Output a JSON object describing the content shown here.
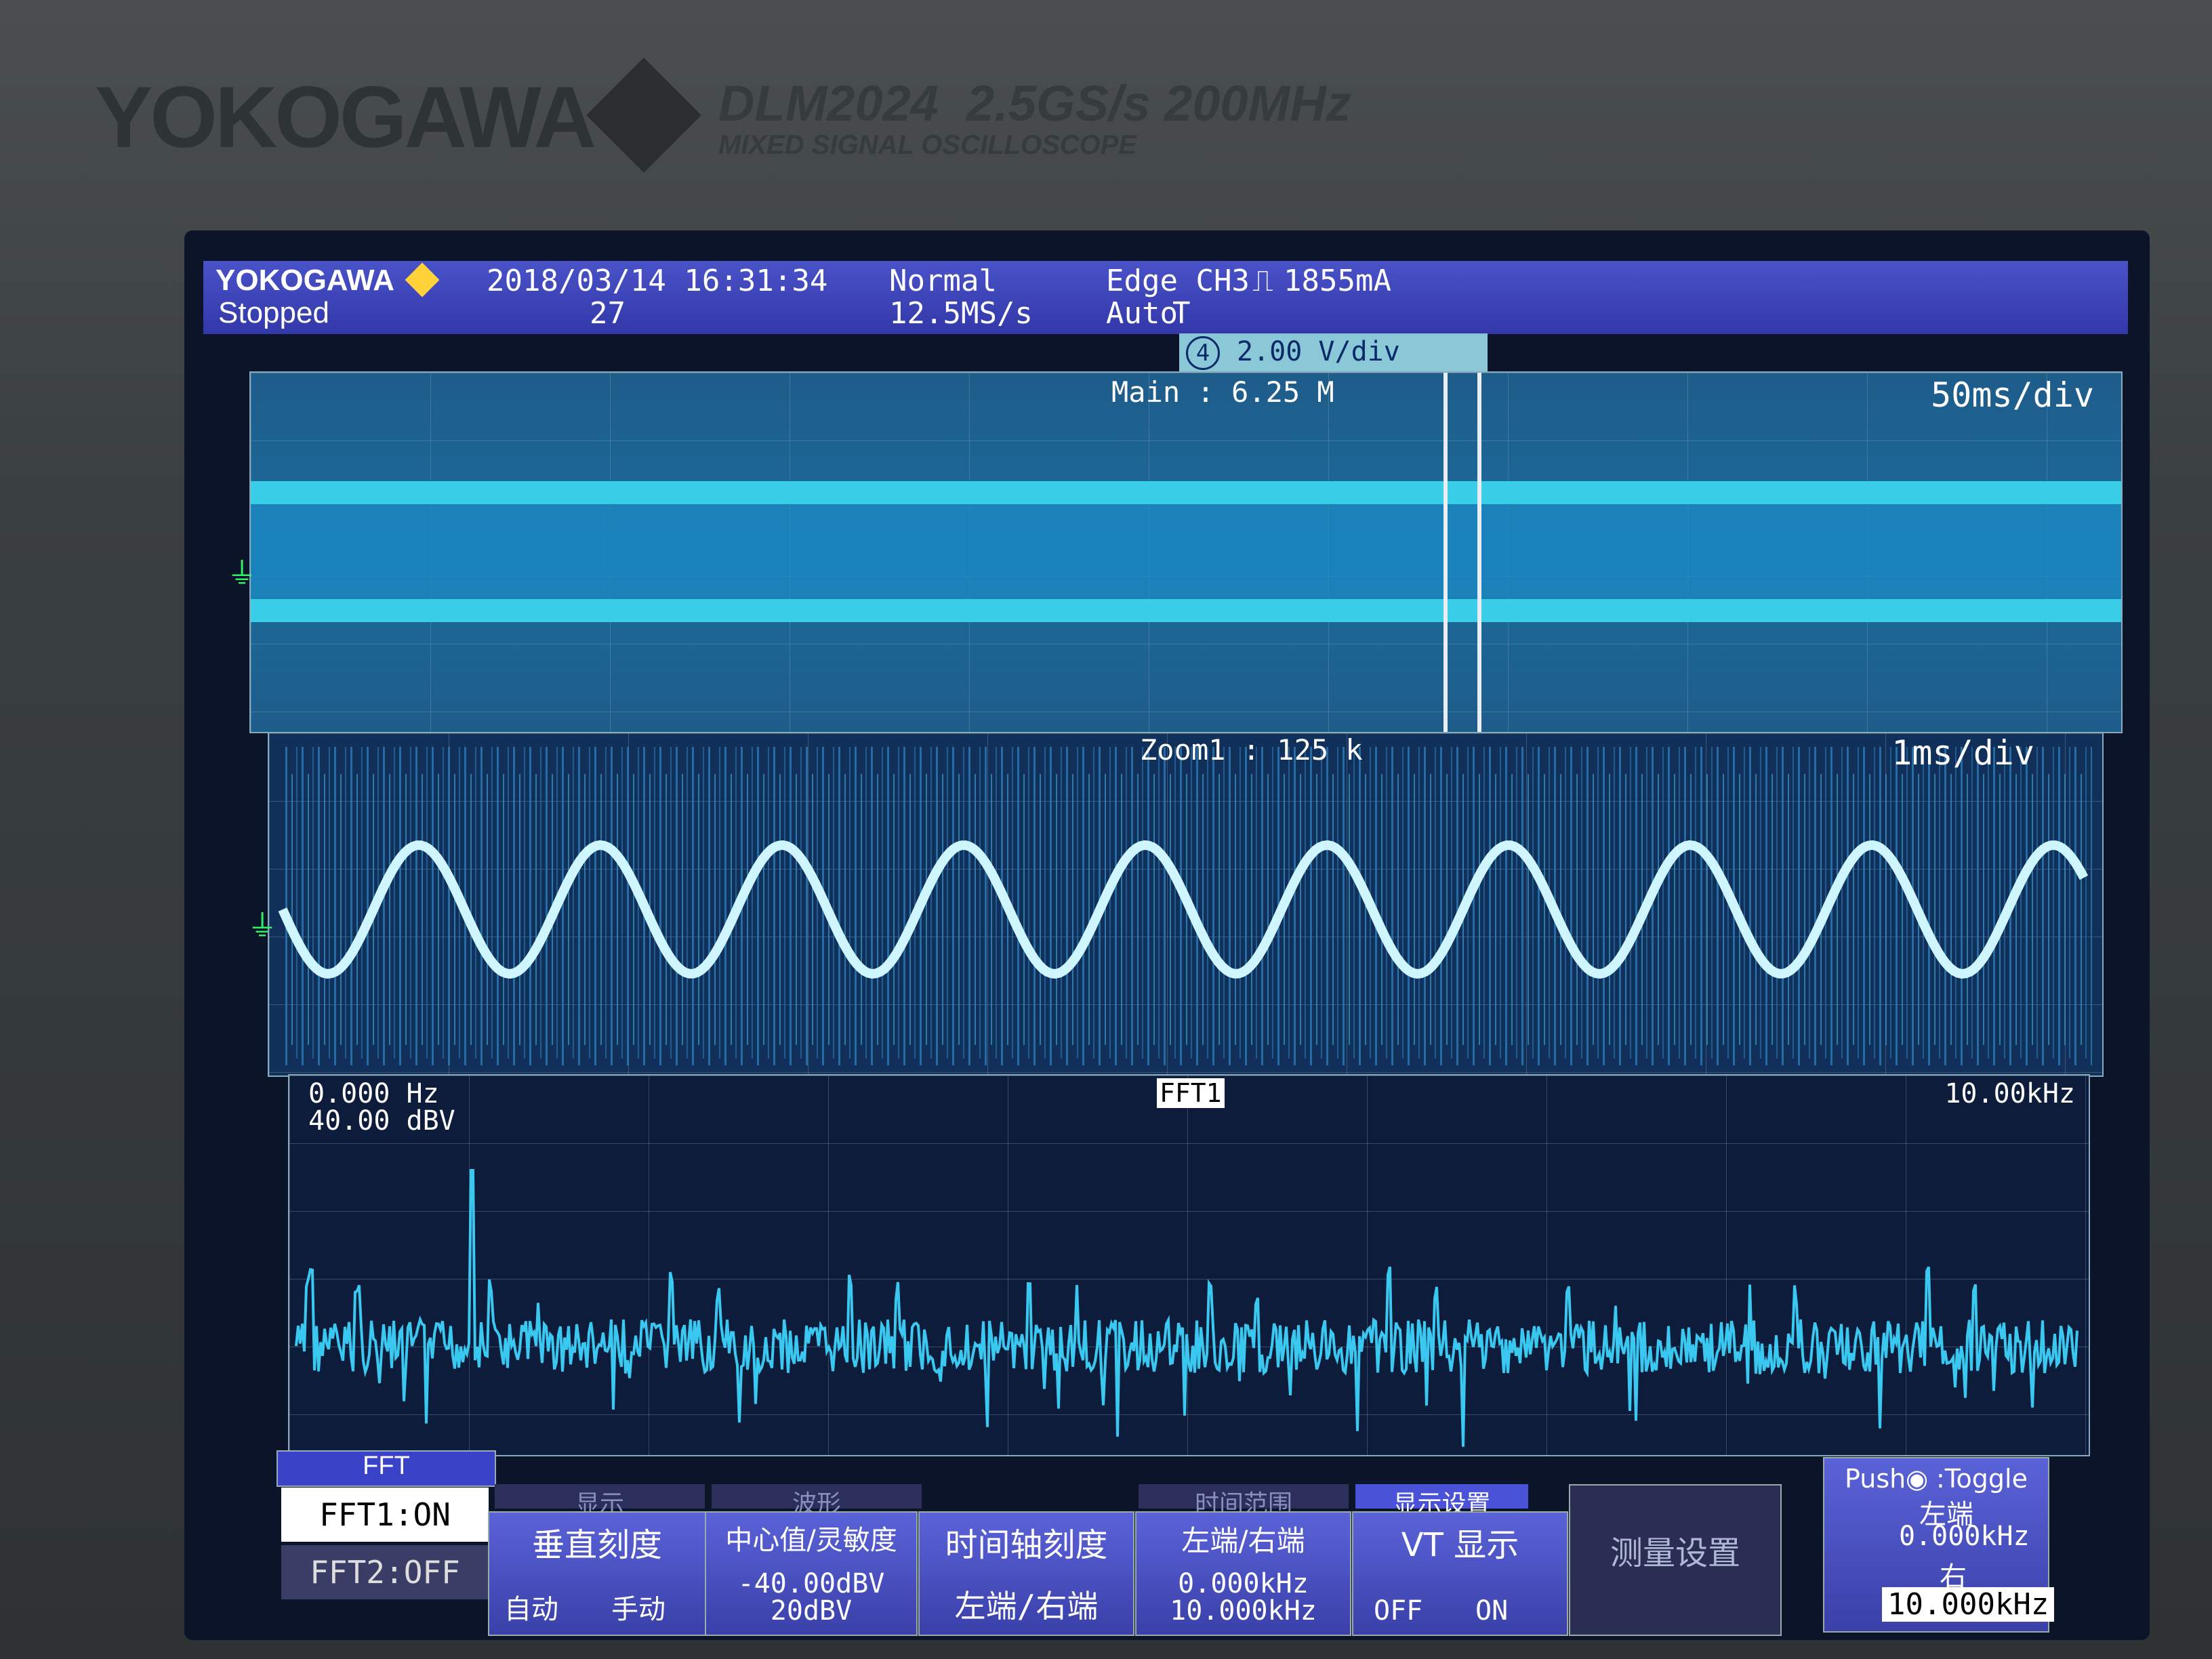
{
  "bezel": {
    "brand": "YOKOGAWA",
    "model": "DLM2024",
    "spec": "2.5GS/s 200MHz",
    "subtitle": "MIXED SIGNAL OSCILLOSCOPE"
  },
  "status": {
    "logo": "YOKOGAWA",
    "state": "Stopped",
    "datetime": "2018/03/14 16:31:34",
    "count": "27",
    "acq_mode": "Normal",
    "sample_rate": "12.5MS/s",
    "trigger": "Edge CH3",
    "trigger_level": "1855mA",
    "trigger_mode": "Auto",
    "trigger_marker": "T"
  },
  "channel_tab": {
    "channel": "4",
    "scale": "2.00 V/div"
  },
  "main": {
    "record": "Main : 6.25 M",
    "timebase": "50ms/div"
  },
  "zoom": {
    "record": "Zoom1 : 125 k",
    "timebase": "1ms/div"
  },
  "fft": {
    "label": "FFT1",
    "start_freq": "0.000 Hz",
    "ref_level": "40.00 dBV",
    "end_freq": "10.00kHz"
  },
  "menu": {
    "fft_tab": "FFT",
    "fft1": "FFT1:ON",
    "fft2": "FFT2:OFF",
    "vertical_scale": {
      "title": "垂直刻度",
      "auto": "自动",
      "manual": "手动",
      "header": "显示"
    },
    "center_sensitivity": {
      "title": "中心值/灵敏度",
      "center": "-40.00dBV",
      "sensitivity": "20dBV",
      "header": "波形"
    },
    "time_axis": {
      "title": "时间轴刻度",
      "value": "左端/右端"
    },
    "left_right": {
      "title": "左端/右端",
      "left": "0.000kHz",
      "right": "10.000kHz",
      "header": "时间范围"
    },
    "vt_display": {
      "title": "VT 显示",
      "off": "OFF",
      "on": "ON",
      "header": "显示设置"
    },
    "measure": {
      "title": "测量设置"
    },
    "knob": {
      "title": "Push",
      "toggle": ":Toggle",
      "left_label": "左端",
      "left_value": "0.000kHz",
      "right_label": "右",
      "right_value": "10.000kHz"
    }
  },
  "colors": {
    "trace": "#4fd8f0",
    "header": "#3a42b8",
    "ground_marker": "#33ee66"
  },
  "icons": [
    "ground-icon",
    "trigger-edge-icon",
    "knob-icon"
  ]
}
